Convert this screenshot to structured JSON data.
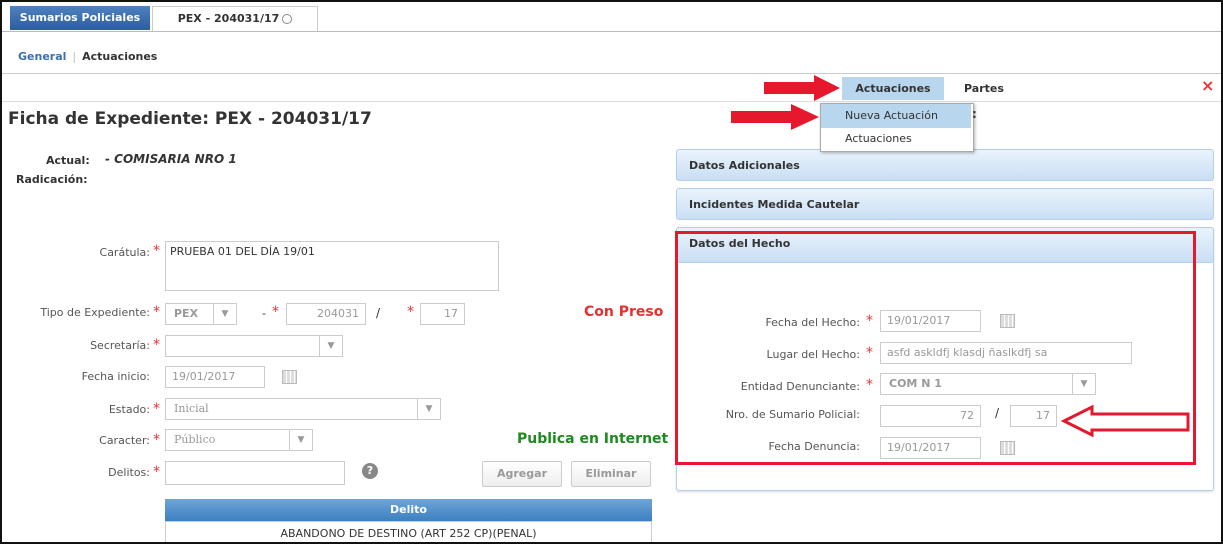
{
  "tabs": {
    "main": "Sumarios Policiales",
    "doc": "PEX - 204031/17"
  },
  "subnav": {
    "general": "General",
    "actuaciones": "Actuaciones"
  },
  "topmenu": {
    "actuaciones": "Actuaciones",
    "partes": "Partes",
    "close": "×"
  },
  "dropdown": {
    "nueva": "Nueva Actuación",
    "actuaciones": "Actuaciones",
    "colon": ":"
  },
  "title": "Ficha de Expediente: PEX - 204031/17",
  "actual": {
    "label": "Actual:",
    "value": "- COMISARIA NRO 1",
    "radicacion": "Radicación:"
  },
  "form": {
    "caratula": {
      "label": "Carátula:",
      "value": "PRUEBA 01 DEL DÍA 19/01"
    },
    "tipo": {
      "label": "Tipo de Expediente:",
      "value": "PEX",
      "dash": "-",
      "numero": "204031",
      "slash": "/",
      "anio": "17"
    },
    "con_preso": "Con Preso",
    "secretaria": {
      "label": "Secretaría:",
      "value": ""
    },
    "fecha_inicio": {
      "label": "Fecha inicio:",
      "value": "19/01/2017"
    },
    "estado": {
      "label": "Estado:",
      "value": "Inicial"
    },
    "caracter": {
      "label": "Caracter:",
      "value": "Público"
    },
    "publica": "Publica en Internet",
    "delitos": {
      "label": "Delitos:",
      "value": "",
      "help": "?"
    },
    "agregar": "Agregar",
    "eliminar": "Eliminar"
  },
  "table": {
    "header": "Delito",
    "rows": [
      "ABANDONO DE DESTINO (ART 252 CP)(PENAL)"
    ]
  },
  "panels": {
    "datos_adicionales": "Datos Adicionales",
    "incidentes": "Incidentes Medida Cautelar",
    "datos_hecho": "Datos del Hecho"
  },
  "hecho": {
    "fecha": {
      "label": "Fecha del Hecho:",
      "value": "19/01/2017"
    },
    "lugar": {
      "label": "Lugar del Hecho:",
      "value": "asfd  askldfj klasdj ñaslkdfj sa"
    },
    "entidad": {
      "label": "Entidad Denunciante:",
      "value": "COM N 1"
    },
    "sumario": {
      "label": "Nro. de Sumario Policial:",
      "numero": "72",
      "slash": "/",
      "anio": "17"
    },
    "denuncia": {
      "label": "Fecha Denuncia:",
      "value": "19/01/2017"
    }
  },
  "colors": {
    "required": "#e33333",
    "con_preso": "#e53030",
    "publica": "#1f8a1f",
    "annotation": "#e5182e",
    "accent": "#3a6fb0"
  }
}
